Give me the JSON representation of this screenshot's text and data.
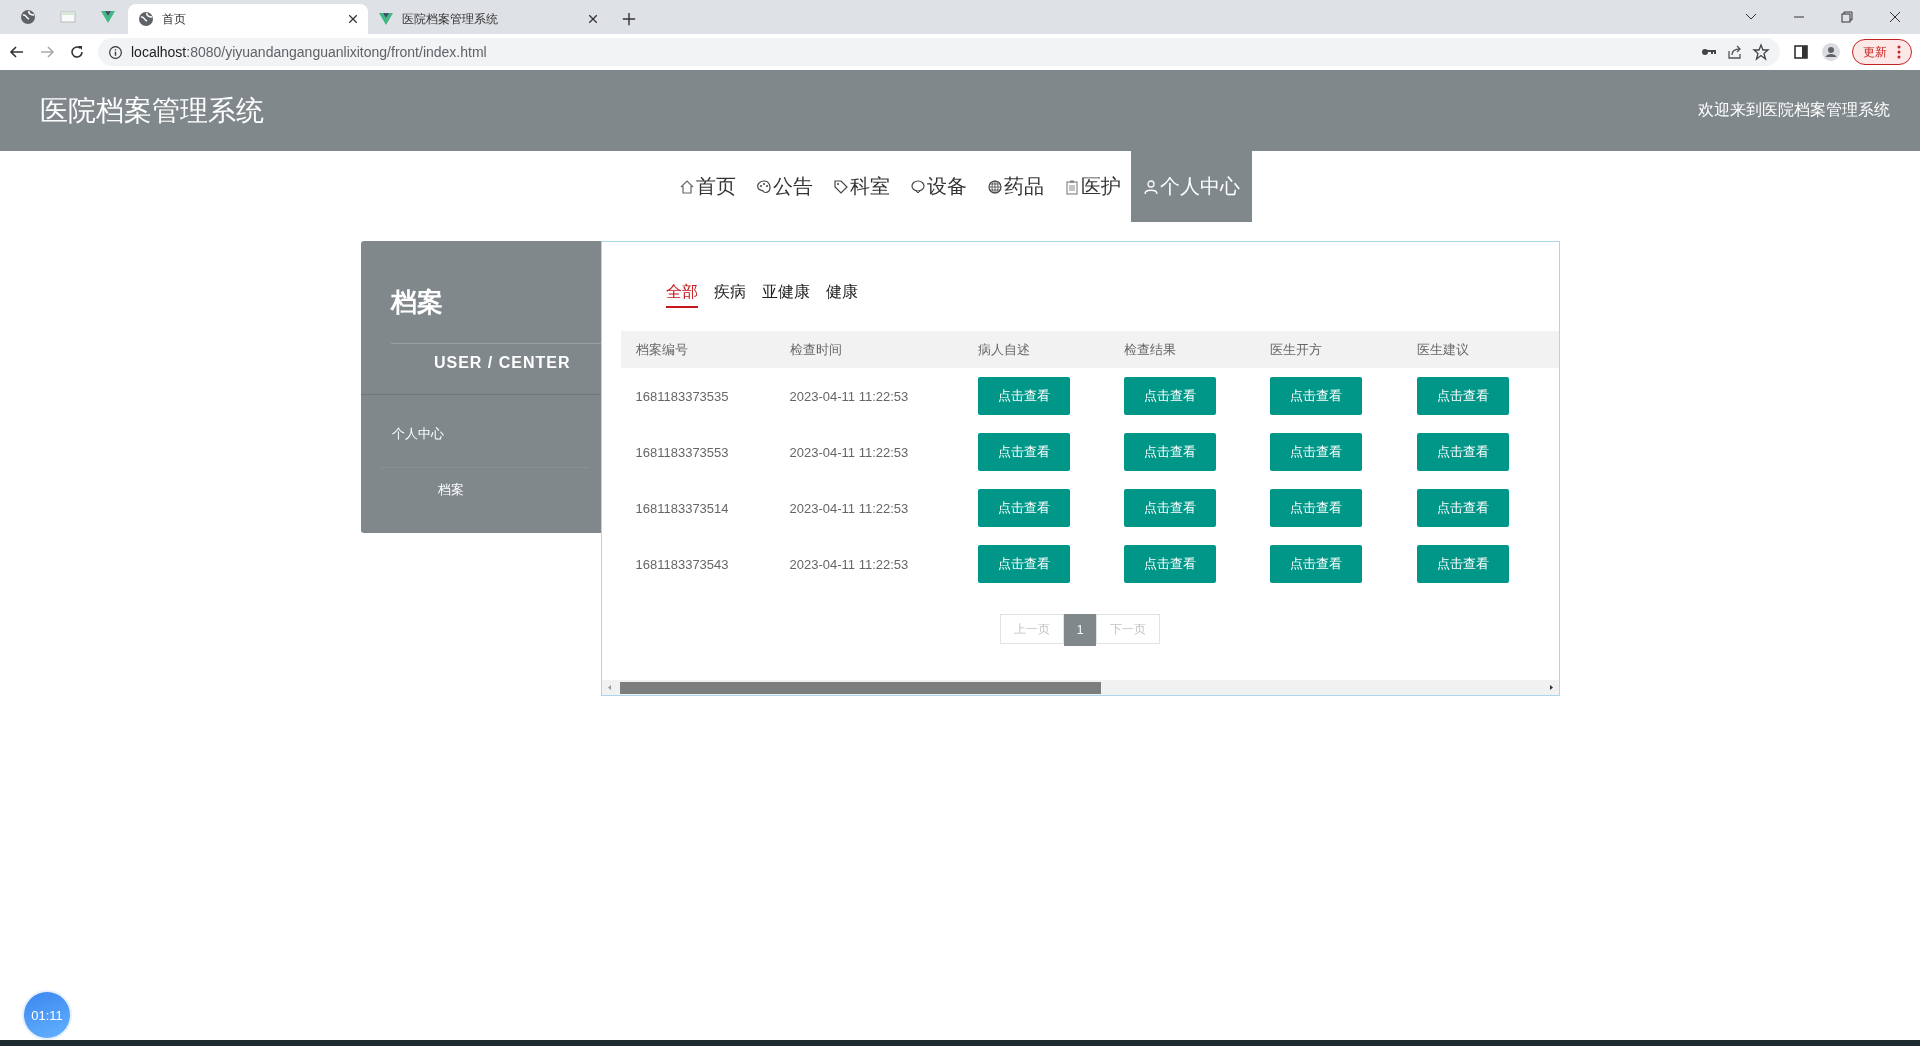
{
  "browser": {
    "tabs": [
      {
        "title": "首页",
        "selected": true
      },
      {
        "title": "医院档案管理系统",
        "selected": false
      }
    ],
    "url_host": "localhost",
    "url_rest": ":8080/yiyuandanganguanlixitong/front/index.html",
    "update_button": "更新"
  },
  "header": {
    "title": "医院档案管理系统",
    "welcome": "欢迎来到医院档案管理系统"
  },
  "nav": [
    {
      "label": "首页",
      "kind": "home",
      "selected": false
    },
    {
      "label": "公告",
      "kind": "palette",
      "selected": false
    },
    {
      "label": "科室",
      "kind": "tag",
      "selected": false
    },
    {
      "label": "设备",
      "kind": "bubble",
      "selected": false
    },
    {
      "label": "药品",
      "kind": "globe",
      "selected": false
    },
    {
      "label": "医护",
      "kind": "clipboard",
      "selected": false
    },
    {
      "label": "个人中心",
      "kind": "user",
      "selected": true
    }
  ],
  "sidebar": {
    "title": "档案",
    "subtitle": "USER / CENTER",
    "items": [
      {
        "label": "个人中心",
        "children": [
          {
            "label": "档案"
          }
        ]
      }
    ]
  },
  "filter_tabs": [
    {
      "label": "全部",
      "selected": true
    },
    {
      "label": "疾病",
      "selected": false
    },
    {
      "label": "亚健康",
      "selected": false
    },
    {
      "label": "健康",
      "selected": false
    }
  ],
  "table": {
    "columns": [
      "档案编号",
      "检查时间",
      "病人自述",
      "检查结果",
      "医生开方",
      "医生建议"
    ],
    "rows": [
      {
        "id": "1681183373535",
        "time": "2023-04-11 11:22:53",
        "actions": [
          "点击查看",
          "点击查看",
          "点击查看",
          "点击查看"
        ]
      },
      {
        "id": "1681183373553",
        "time": "2023-04-11 11:22:53",
        "actions": [
          "点击查看",
          "点击查看",
          "点击查看",
          "点击查看"
        ]
      },
      {
        "id": "1681183373514",
        "time": "2023-04-11 11:22:53",
        "actions": [
          "点击查看",
          "点击查看",
          "点击查看",
          "点击查看"
        ]
      },
      {
        "id": "1681183373543",
        "time": "2023-04-11 11:22:53",
        "actions": [
          "点击查看",
          "点击查看",
          "点击查看",
          "点击查看"
        ]
      }
    ]
  },
  "pagination": {
    "prev": {
      "label": "上一页",
      "disabled": true
    },
    "pages": [
      {
        "label": "1",
        "selected": true
      }
    ],
    "next": {
      "label": "下一页",
      "disabled": true
    }
  },
  "timer": "01:11"
}
